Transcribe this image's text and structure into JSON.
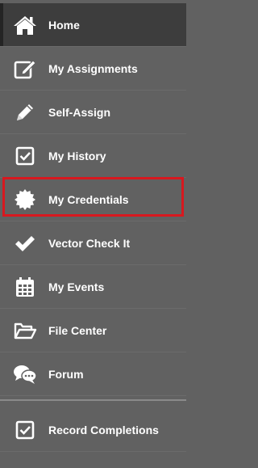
{
  "sidebar": {
    "items": [
      {
        "label": "Home",
        "icon": "home-icon",
        "active": true
      },
      {
        "label": "My Assignments",
        "icon": "edit-icon"
      },
      {
        "label": "Self-Assign",
        "icon": "pencil-icon"
      },
      {
        "label": "My History",
        "icon": "checkbox-icon"
      },
      {
        "label": "My Credentials",
        "icon": "certificate-icon",
        "highlighted": true
      },
      {
        "label": "Vector Check It",
        "icon": "checkmark-icon"
      },
      {
        "label": "My Events",
        "icon": "calendar-icon"
      },
      {
        "label": "File Center",
        "icon": "folder-open-icon"
      },
      {
        "label": "Forum",
        "icon": "chat-bubbles-icon"
      }
    ],
    "footer_items": [
      {
        "label": "Record Completions",
        "icon": "checkbox-icon"
      }
    ]
  },
  "colors": {
    "background": "#616161",
    "active_background": "#3d3d3d",
    "text": "#ffffff",
    "highlight_border": "#d7181f"
  }
}
